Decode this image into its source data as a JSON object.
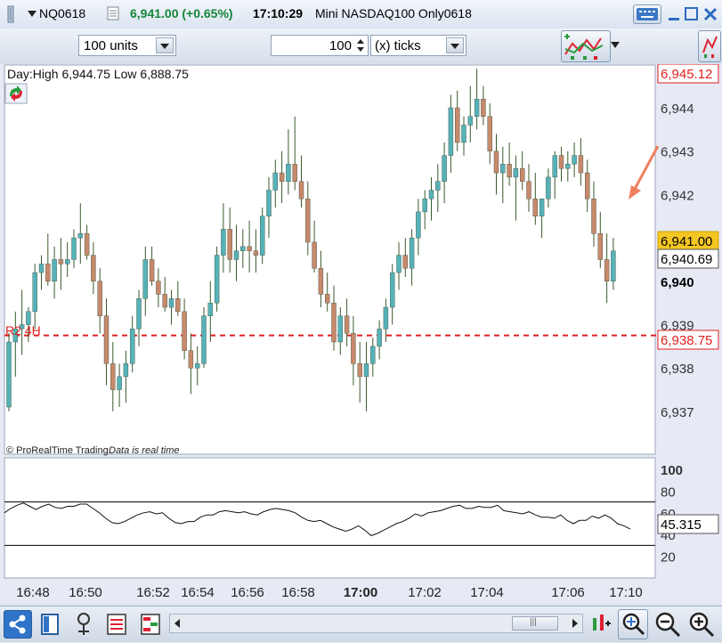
{
  "header": {
    "symbol": "NQ0618",
    "price_change": "6,941.00 (+0.65%)",
    "time": "17:10:29",
    "instrument_name": "Mini NASDAQ100 Only0618"
  },
  "toolbar": {
    "units_value": "100 units",
    "ticks_value": "100",
    "ticks_unit": "(x) ticks"
  },
  "chart": {
    "day_info": "Day:High 6,944.75 Low 6,888.75",
    "pivot_label": "R2 4H",
    "credit": "© ProRealTime Trading",
    "realtime_note": "Data is real time",
    "colors": {
      "bull": "#55b3b8",
      "bear": "#c7896b",
      "wick": "#3b5a2d",
      "level": "#e02020",
      "highlight": "#f5c623"
    },
    "price_labels": {
      "high": "6,945.12",
      "last": "6,941.00",
      "current": "6,940.69",
      "pivot": "6,938.75"
    }
  },
  "chart_data": [
    {
      "type": "candlestick",
      "title": "",
      "y_ticks": [
        "6,944",
        "6,943",
        "6,942",
        "6,941",
        "6,940",
        "6,939",
        "6,938",
        "6,937"
      ],
      "ylim": [
        6936.6,
        6945.2
      ],
      "x_ticks": [
        "16:48",
        "16:50",
        "16:52",
        "16:54",
        "16:56",
        "16:58",
        "17:00",
        "17:02",
        "17:04",
        "17:06",
        "17:10"
      ],
      "reference_lines": [
        {
          "label": "Day High",
          "value": 6945.12,
          "style": "dashed"
        },
        {
          "label": "R2 4H",
          "value": 6938.75,
          "style": "dashed"
        }
      ],
      "candles": [
        [
          6937.1,
          6938.8,
          6937.0,
          6938.6
        ],
        [
          6938.6,
          6939.3,
          6937.8,
          6938.9
        ],
        [
          6938.9,
          6939.8,
          6938.3,
          6939.0
        ],
        [
          6939.0,
          6939.4,
          6938.6,
          6939.3
        ],
        [
          6939.3,
          6940.4,
          6938.9,
          6940.2
        ],
        [
          6940.2,
          6940.6,
          6939.8,
          6940.4
        ],
        [
          6940.4,
          6941.1,
          6939.9,
          6940.0
        ],
        [
          6940.0,
          6940.8,
          6939.6,
          6940.5
        ],
        [
          6940.5,
          6941.0,
          6939.8,
          6940.4
        ],
        [
          6940.4,
          6940.9,
          6940.1,
          6940.5
        ],
        [
          6940.5,
          6941.2,
          6940.3,
          6941.0
        ],
        [
          6941.0,
          6941.8,
          6940.4,
          6941.1
        ],
        [
          6941.1,
          6941.3,
          6940.5,
          6940.6
        ],
        [
          6940.6,
          6940.9,
          6939.7,
          6940.0
        ],
        [
          6940.0,
          6940.3,
          6938.8,
          6939.2
        ],
        [
          6939.2,
          6939.6,
          6937.6,
          6938.1
        ],
        [
          6938.1,
          6938.6,
          6937.0,
          6937.5
        ],
        [
          6937.5,
          6938.1,
          6937.1,
          6937.8
        ],
        [
          6937.8,
          6938.4,
          6937.2,
          6938.1
        ],
        [
          6938.1,
          6939.2,
          6937.9,
          6938.9
        ],
        [
          6938.9,
          6939.8,
          6938.5,
          6939.6
        ],
        [
          6939.6,
          6940.8,
          6939.2,
          6940.5
        ],
        [
          6940.5,
          6940.8,
          6939.9,
          6940.0
        ],
        [
          6940.0,
          6940.3,
          6939.4,
          6939.7
        ],
        [
          6939.7,
          6940.1,
          6939.3,
          6939.4
        ],
        [
          6939.4,
          6939.8,
          6939.0,
          6939.6
        ],
        [
          6939.6,
          6940.0,
          6939.2,
          6939.3
        ],
        [
          6939.3,
          6939.6,
          6938.2,
          6938.4
        ],
        [
          6938.4,
          6938.8,
          6937.4,
          6938.0
        ],
        [
          6938.0,
          6938.5,
          6937.6,
          6938.1
        ],
        [
          6938.1,
          6939.4,
          6938.0,
          6939.2
        ],
        [
          6939.2,
          6940.0,
          6938.6,
          6939.5
        ],
        [
          6939.5,
          6940.8,
          6939.3,
          6940.6
        ],
        [
          6940.6,
          6941.8,
          6940.2,
          6941.2
        ],
        [
          6941.2,
          6941.7,
          6940.2,
          6940.5
        ],
        [
          6940.5,
          6941.3,
          6940.0,
          6940.7
        ],
        [
          6940.7,
          6941.2,
          6940.3,
          6940.8
        ],
        [
          6940.8,
          6941.4,
          6940.2,
          6940.7
        ],
        [
          6940.7,
          6941.2,
          6940.2,
          6940.6
        ],
        [
          6940.6,
          6941.7,
          6940.4,
          6941.5
        ],
        [
          6941.5,
          6942.4,
          6941.0,
          6942.1
        ],
        [
          6942.1,
          6942.8,
          6941.7,
          6942.5
        ],
        [
          6942.5,
          6943.0,
          6941.8,
          6942.3
        ],
        [
          6942.3,
          6943.5,
          6942.0,
          6942.7
        ],
        [
          6942.7,
          6943.8,
          6942.1,
          6942.3
        ],
        [
          6942.3,
          6942.9,
          6941.7,
          6941.9
        ],
        [
          6941.9,
          6942.3,
          6940.6,
          6940.9
        ],
        [
          6940.9,
          6941.4,
          6940.2,
          6940.3
        ],
        [
          6940.3,
          6940.7,
          6939.4,
          6939.7
        ],
        [
          6939.7,
          6940.2,
          6939.3,
          6939.5
        ],
        [
          6939.5,
          6939.9,
          6938.4,
          6938.6
        ],
        [
          6938.6,
          6939.4,
          6938.3,
          6939.2
        ],
        [
          6939.2,
          6939.6,
          6938.5,
          6938.8
        ],
        [
          6938.8,
          6939.2,
          6937.6,
          6938.1
        ],
        [
          6938.1,
          6938.6,
          6937.2,
          6937.8
        ],
        [
          6937.8,
          6938.6,
          6937.0,
          6938.1
        ],
        [
          6938.1,
          6938.7,
          6937.8,
          6938.5
        ],
        [
          6938.5,
          6939.1,
          6938.2,
          6938.9
        ],
        [
          6938.9,
          6939.6,
          6938.6,
          6939.4
        ],
        [
          6939.4,
          6940.4,
          6939.0,
          6940.2
        ],
        [
          6940.2,
          6940.9,
          6939.8,
          6940.6
        ],
        [
          6940.6,
          6941.0,
          6940.1,
          6940.3
        ],
        [
          6940.3,
          6941.2,
          6939.9,
          6941.0
        ],
        [
          6941.0,
          6941.9,
          6940.6,
          6941.6
        ],
        [
          6941.6,
          6942.1,
          6941.2,
          6941.9
        ],
        [
          6941.9,
          6942.4,
          6941.4,
          6942.1
        ],
        [
          6942.1,
          6942.7,
          6941.6,
          6942.3
        ],
        [
          6942.3,
          6943.2,
          6941.8,
          6942.9
        ],
        [
          6942.9,
          6944.3,
          6942.5,
          6944.0
        ],
        [
          6944.0,
          6944.4,
          6943.0,
          6943.2
        ],
        [
          6943.2,
          6943.8,
          6942.9,
          6943.6
        ],
        [
          6943.6,
          6944.5,
          6943.2,
          6943.8
        ],
        [
          6943.8,
          6944.9,
          6943.5,
          6944.2
        ],
        [
          6944.2,
          6944.5,
          6943.6,
          6943.8
        ],
        [
          6943.8,
          6944.1,
          6942.7,
          6943.0
        ],
        [
          6943.0,
          6943.4,
          6942.0,
          6942.5
        ],
        [
          6942.5,
          6943.1,
          6941.8,
          6942.7
        ],
        [
          6942.7,
          6943.2,
          6942.2,
          6942.4
        ],
        [
          6942.4,
          6942.9,
          6941.4,
          6942.6
        ],
        [
          6942.6,
          6943.0,
          6942.1,
          6942.3
        ],
        [
          6942.3,
          6942.7,
          6941.6,
          6941.9
        ],
        [
          6941.9,
          6942.5,
          6941.3,
          6941.5
        ],
        [
          6941.5,
          6941.9,
          6941.0,
          6941.9
        ],
        [
          6941.9,
          6942.6,
          6941.7,
          6942.4
        ],
        [
          6942.4,
          6943.0,
          6941.9,
          6942.9
        ],
        [
          6942.9,
          6943.1,
          6942.3,
          6942.6
        ],
        [
          6942.6,
          6943.0,
          6942.3,
          6942.7
        ],
        [
          6942.7,
          6943.2,
          6942.4,
          6942.9
        ],
        [
          6942.9,
          6943.3,
          6942.2,
          6942.5
        ],
        [
          6942.5,
          6942.8,
          6941.6,
          6941.9
        ],
        [
          6941.9,
          6942.3,
          6940.8,
          6941.1
        ],
        [
          6941.1,
          6941.6,
          6940.3,
          6940.5
        ],
        [
          6940.5,
          6941.1,
          6939.5,
          6940.0
        ],
        [
          6940.0,
          6941.0,
          6939.8,
          6940.7
        ]
      ]
    },
    {
      "type": "line",
      "title": "",
      "y_ticks": [
        "100",
        "80",
        "60",
        "40",
        "20"
      ],
      "ylim": [
        0,
        100
      ],
      "reference_lines": [
        70,
        30
      ],
      "last_value_label": "45.315",
      "values": [
        60,
        64,
        67,
        69,
        66,
        63,
        66,
        68,
        65,
        64,
        66,
        66,
        68,
        68,
        64,
        60,
        55,
        51,
        50,
        52,
        55,
        58,
        60,
        61,
        59,
        60,
        55,
        51,
        50,
        52,
        52,
        56,
        58,
        58,
        61,
        62,
        61,
        60,
        61,
        59,
        58,
        61,
        63,
        64,
        63,
        62,
        60,
        56,
        53,
        52,
        53,
        50,
        47,
        45,
        43,
        45,
        48,
        44,
        39,
        41,
        44,
        47,
        50,
        52,
        55,
        59,
        57,
        60,
        61,
        62,
        64,
        66,
        67,
        64,
        64,
        66,
        65,
        65,
        67,
        62,
        61,
        60,
        59,
        61,
        58,
        56,
        56,
        55,
        58,
        53,
        50,
        53,
        53,
        57,
        55,
        58,
        55,
        50,
        48,
        45
      ]
    }
  ],
  "status": {
    "scroll_thumb": "|||"
  }
}
